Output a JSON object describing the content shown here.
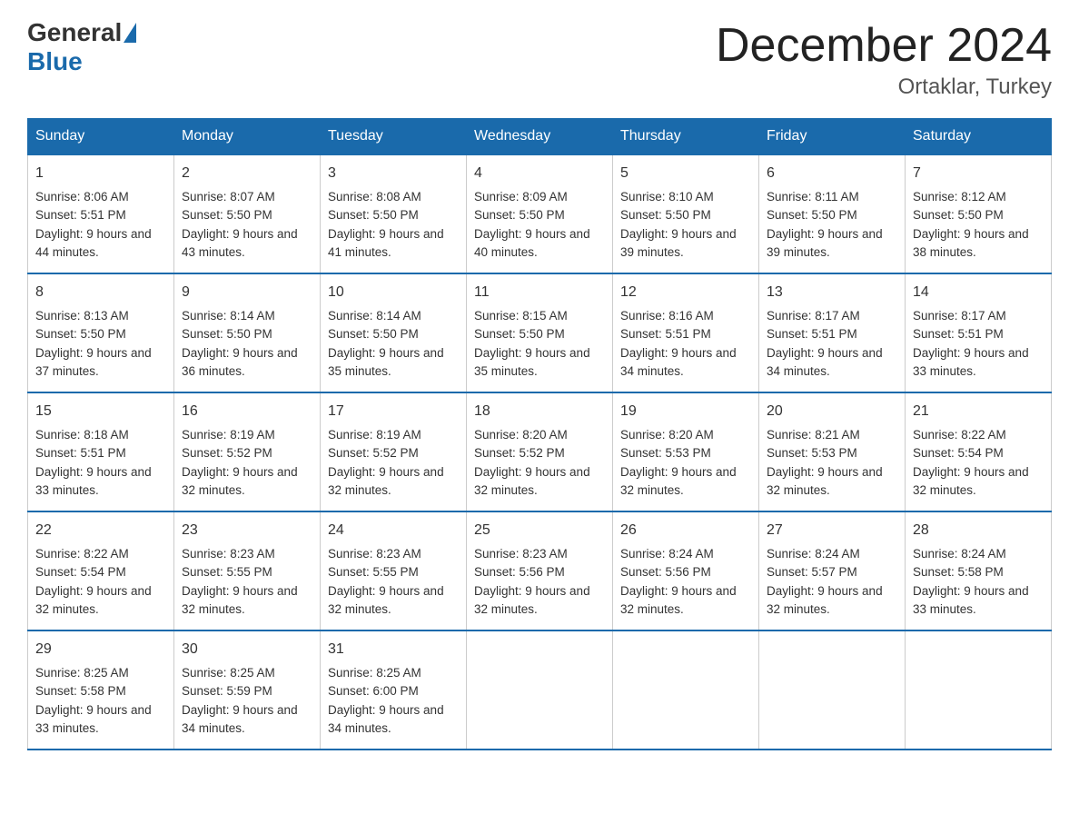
{
  "logo": {
    "general": "General",
    "blue": "Blue"
  },
  "title": {
    "month_year": "December 2024",
    "location": "Ortaklar, Turkey"
  },
  "weekdays": [
    "Sunday",
    "Monday",
    "Tuesday",
    "Wednesday",
    "Thursday",
    "Friday",
    "Saturday"
  ],
  "weeks": [
    [
      {
        "day": "1",
        "sunrise": "8:06 AM",
        "sunset": "5:51 PM",
        "daylight": "9 hours and 44 minutes."
      },
      {
        "day": "2",
        "sunrise": "8:07 AM",
        "sunset": "5:50 PM",
        "daylight": "9 hours and 43 minutes."
      },
      {
        "day": "3",
        "sunrise": "8:08 AM",
        "sunset": "5:50 PM",
        "daylight": "9 hours and 41 minutes."
      },
      {
        "day": "4",
        "sunrise": "8:09 AM",
        "sunset": "5:50 PM",
        "daylight": "9 hours and 40 minutes."
      },
      {
        "day": "5",
        "sunrise": "8:10 AM",
        "sunset": "5:50 PM",
        "daylight": "9 hours and 39 minutes."
      },
      {
        "day": "6",
        "sunrise": "8:11 AM",
        "sunset": "5:50 PM",
        "daylight": "9 hours and 39 minutes."
      },
      {
        "day": "7",
        "sunrise": "8:12 AM",
        "sunset": "5:50 PM",
        "daylight": "9 hours and 38 minutes."
      }
    ],
    [
      {
        "day": "8",
        "sunrise": "8:13 AM",
        "sunset": "5:50 PM",
        "daylight": "9 hours and 37 minutes."
      },
      {
        "day": "9",
        "sunrise": "8:14 AM",
        "sunset": "5:50 PM",
        "daylight": "9 hours and 36 minutes."
      },
      {
        "day": "10",
        "sunrise": "8:14 AM",
        "sunset": "5:50 PM",
        "daylight": "9 hours and 35 minutes."
      },
      {
        "day": "11",
        "sunrise": "8:15 AM",
        "sunset": "5:50 PM",
        "daylight": "9 hours and 35 minutes."
      },
      {
        "day": "12",
        "sunrise": "8:16 AM",
        "sunset": "5:51 PM",
        "daylight": "9 hours and 34 minutes."
      },
      {
        "day": "13",
        "sunrise": "8:17 AM",
        "sunset": "5:51 PM",
        "daylight": "9 hours and 34 minutes."
      },
      {
        "day": "14",
        "sunrise": "8:17 AM",
        "sunset": "5:51 PM",
        "daylight": "9 hours and 33 minutes."
      }
    ],
    [
      {
        "day": "15",
        "sunrise": "8:18 AM",
        "sunset": "5:51 PM",
        "daylight": "9 hours and 33 minutes."
      },
      {
        "day": "16",
        "sunrise": "8:19 AM",
        "sunset": "5:52 PM",
        "daylight": "9 hours and 32 minutes."
      },
      {
        "day": "17",
        "sunrise": "8:19 AM",
        "sunset": "5:52 PM",
        "daylight": "9 hours and 32 minutes."
      },
      {
        "day": "18",
        "sunrise": "8:20 AM",
        "sunset": "5:52 PM",
        "daylight": "9 hours and 32 minutes."
      },
      {
        "day": "19",
        "sunrise": "8:20 AM",
        "sunset": "5:53 PM",
        "daylight": "9 hours and 32 minutes."
      },
      {
        "day": "20",
        "sunrise": "8:21 AM",
        "sunset": "5:53 PM",
        "daylight": "9 hours and 32 minutes."
      },
      {
        "day": "21",
        "sunrise": "8:22 AM",
        "sunset": "5:54 PM",
        "daylight": "9 hours and 32 minutes."
      }
    ],
    [
      {
        "day": "22",
        "sunrise": "8:22 AM",
        "sunset": "5:54 PM",
        "daylight": "9 hours and 32 minutes."
      },
      {
        "day": "23",
        "sunrise": "8:23 AM",
        "sunset": "5:55 PM",
        "daylight": "9 hours and 32 minutes."
      },
      {
        "day": "24",
        "sunrise": "8:23 AM",
        "sunset": "5:55 PM",
        "daylight": "9 hours and 32 minutes."
      },
      {
        "day": "25",
        "sunrise": "8:23 AM",
        "sunset": "5:56 PM",
        "daylight": "9 hours and 32 minutes."
      },
      {
        "day": "26",
        "sunrise": "8:24 AM",
        "sunset": "5:56 PM",
        "daylight": "9 hours and 32 minutes."
      },
      {
        "day": "27",
        "sunrise": "8:24 AM",
        "sunset": "5:57 PM",
        "daylight": "9 hours and 32 minutes."
      },
      {
        "day": "28",
        "sunrise": "8:24 AM",
        "sunset": "5:58 PM",
        "daylight": "9 hours and 33 minutes."
      }
    ],
    [
      {
        "day": "29",
        "sunrise": "8:25 AM",
        "sunset": "5:58 PM",
        "daylight": "9 hours and 33 minutes."
      },
      {
        "day": "30",
        "sunrise": "8:25 AM",
        "sunset": "5:59 PM",
        "daylight": "9 hours and 34 minutes."
      },
      {
        "day": "31",
        "sunrise": "8:25 AM",
        "sunset": "6:00 PM",
        "daylight": "9 hours and 34 minutes."
      },
      null,
      null,
      null,
      null
    ]
  ]
}
